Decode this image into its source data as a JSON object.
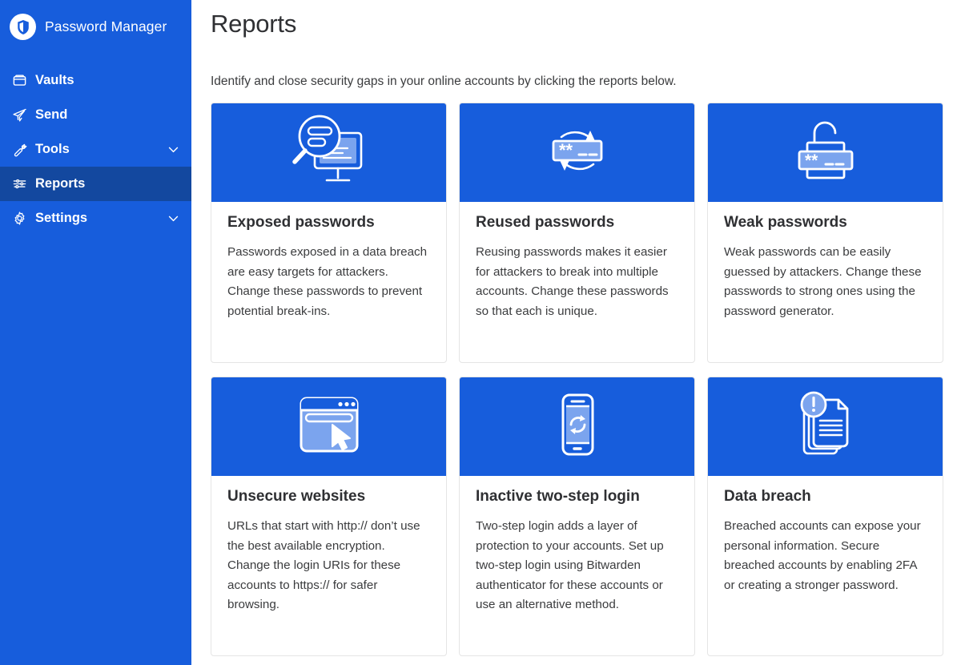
{
  "sidebar": {
    "brand": {
      "name": "Password Manager",
      "logo_icon": "bitwarden-shield-logo"
    },
    "items": [
      {
        "label": "Vaults",
        "icon": "vault-icon",
        "active": false,
        "chevron": false
      },
      {
        "label": "Send",
        "icon": "send-paper-plane-icon",
        "active": false,
        "chevron": false
      },
      {
        "label": "Tools",
        "icon": "wrench-icon",
        "active": false,
        "chevron": true
      },
      {
        "label": "Reports",
        "icon": "sliders-icon",
        "active": true,
        "chevron": false
      },
      {
        "label": "Settings",
        "icon": "gear-icon",
        "active": false,
        "chevron": true
      }
    ]
  },
  "main": {
    "title": "Reports",
    "description": "Identify and close security gaps in your online accounts by clicking the reports below.",
    "cards": [
      {
        "icon": "magnifier-monitor-icon",
        "title": "Exposed passwords",
        "text": "Passwords exposed in a data breach are easy targets for attackers. Change these passwords to prevent potential break-ins."
      },
      {
        "icon": "password-field-refresh-icon",
        "title": "Reused passwords",
        "text": "Reusing passwords makes it easier for attackers to break into multiple accounts. Change these passwords so that each is unique."
      },
      {
        "icon": "open-padlock-password-icon",
        "title": "Weak passwords",
        "text": "Weak passwords can be easily guessed by attackers. Change these passwords to strong ones using the password generator."
      },
      {
        "icon": "browser-window-cursor-icon",
        "title": "Unsecure websites",
        "text": "URLs that start with http:// don’t use the best available encryption. Change the login URIs for these accounts to https:// for safer browsing."
      },
      {
        "icon": "mobile-phone-sync-icon",
        "title": "Inactive two-step login",
        "text": "Two-step login adds a layer of protection to your accounts. Set up two-step login using Bitwarden authenticator for these accounts or use an alternative method."
      },
      {
        "icon": "documents-alert-icon",
        "title": "Data breach",
        "text": "Breached accounts can expose your personal information. Secure breached accounts by enabling 2FA or creating a stronger password."
      }
    ]
  },
  "colors": {
    "brand_blue": "#175DDC",
    "sidebar_active": "#13489F",
    "card_border": "#E5E5E5",
    "text_dark": "#2F3033",
    "icon_accent": "#7BA4EE"
  }
}
